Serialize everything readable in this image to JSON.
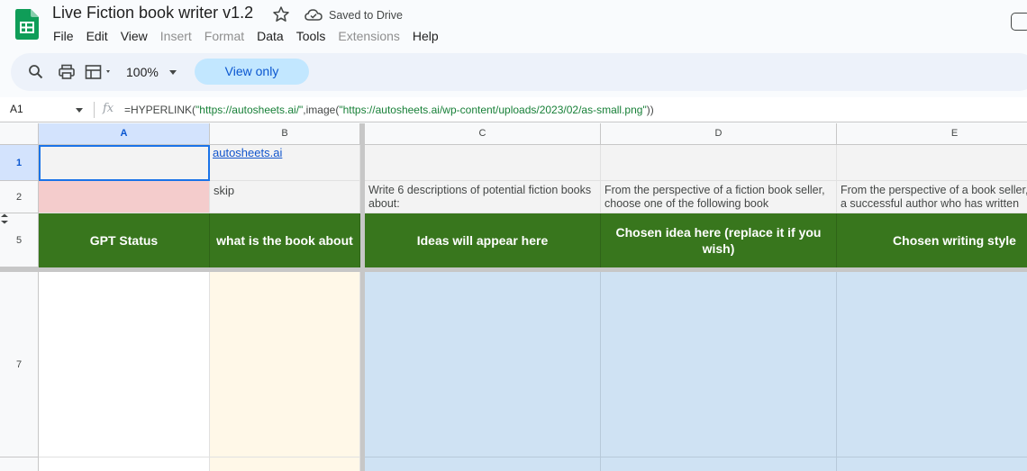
{
  "app": {
    "title": "Live Fiction book writer v1.2",
    "saved_status": "Saved to Drive"
  },
  "menu": [
    {
      "label": "File",
      "enabled": true
    },
    {
      "label": "Edit",
      "enabled": true
    },
    {
      "label": "View",
      "enabled": true
    },
    {
      "label": "Insert",
      "enabled": false
    },
    {
      "label": "Format",
      "enabled": false
    },
    {
      "label": "Data",
      "enabled": true
    },
    {
      "label": "Tools",
      "enabled": true
    },
    {
      "label": "Extensions",
      "enabled": false
    },
    {
      "label": "Help",
      "enabled": true
    }
  ],
  "toolbar": {
    "zoom": "100%",
    "view_only_label": "View only"
  },
  "formula_bar": {
    "cell_ref": "A1",
    "formula_prefix": "=HYPERLINK(",
    "formula_arg1": "\"https://autosheets.ai/\"",
    "formula_mid": ",image(",
    "formula_arg2": "\"https://autosheets.ai/wp-content/uploads/2023/02/as-small.png\"",
    "formula_suffix": "))"
  },
  "columns": [
    "A",
    "B",
    "C",
    "D",
    "E"
  ],
  "rows": [
    "1",
    "2",
    "5",
    "7"
  ],
  "cells": {
    "B1": "autosheets.ai",
    "B2": "skip",
    "C2": "Write 6 descriptions of potential fiction books about:",
    "D2": "From the perspective of a fiction book seller, choose one of the following book",
    "E2": "From the perspective of a book seller, a successful author who has written",
    "A5": "GPT Status",
    "B5": "what is the book about",
    "C5": "Ideas will appear here",
    "D5": "Chosen idea here (replace it if you wish)",
    "E5": "Chosen writing style"
  },
  "colors": {
    "header_green": "#38761d",
    "pink": "#f4cccc",
    "cream": "#fff8e8",
    "light_blue": "#cfe2f3",
    "selection": "#1a73e8",
    "view_only_bg": "#c2e7ff"
  },
  "icons": [
    "sheets-logo-icon",
    "star-icon",
    "cloud-saved-icon",
    "search-icon",
    "print-icon",
    "format-painter-icon",
    "fx-icon"
  ]
}
